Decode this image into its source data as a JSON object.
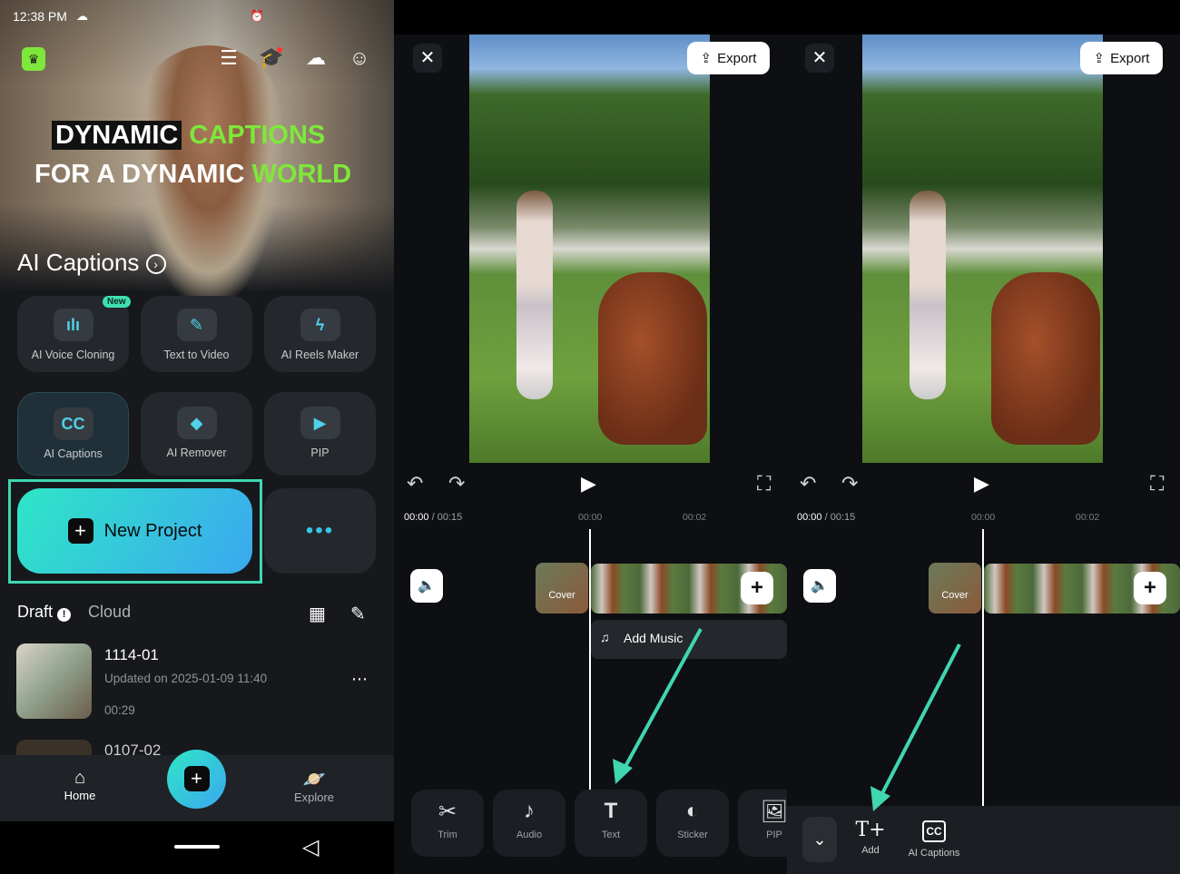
{
  "home": {
    "status_time": "12:38 PM",
    "banner": {
      "line1_boxed": "DYNAMIC",
      "line1_green": "CAPTIONS",
      "line2_white": "FOR A DYNAMIC",
      "line2_green": "WORLD",
      "feature_link": "AI Captions"
    },
    "new_badge": "New",
    "tools": [
      {
        "label": "AI Voice Cloning",
        "icon": "voice-wave-icon"
      },
      {
        "label": "Text to Video",
        "icon": "pencil-video-icon"
      },
      {
        "label": "AI Reels Maker",
        "icon": "lightning-icon"
      },
      {
        "label": "AI Captions",
        "icon": "cc-icon"
      },
      {
        "label": "AI Remover",
        "icon": "eraser-icon"
      },
      {
        "label": "PIP",
        "icon": "pip-icon"
      }
    ],
    "new_project_label": "New Project",
    "tabs": {
      "draft": "Draft",
      "cloud": "Cloud"
    },
    "drafts": [
      {
        "title": "1114-01",
        "updated": "Updated on 2025-01-09 11:40",
        "duration": "00:29"
      },
      {
        "title": "0107-02"
      }
    ],
    "nav": {
      "home": "Home",
      "explore": "Explore"
    },
    "accent": "#2fe6c6"
  },
  "editor": {
    "export_label": "Export",
    "current_time": "00:00",
    "total_time": "00:15",
    "ruler": [
      "00:00",
      "00:02"
    ],
    "cover_label": "Cover",
    "add_music_label": "Add Music",
    "toolbar": [
      {
        "label": "Trim",
        "icon": "scissors-icon"
      },
      {
        "label": "Audio",
        "icon": "music-note-icon"
      },
      {
        "label": "Text",
        "icon": "text-icon"
      },
      {
        "label": "Sticker",
        "icon": "sticker-icon"
      },
      {
        "label": "PIP",
        "icon": "image-icon"
      }
    ],
    "text_menu": [
      {
        "label": "Add",
        "icon": "text-add-icon"
      },
      {
        "label": "AI Captions",
        "icon": "cc-ai-icon"
      }
    ],
    "arrow_color": "#3fd6b0"
  }
}
